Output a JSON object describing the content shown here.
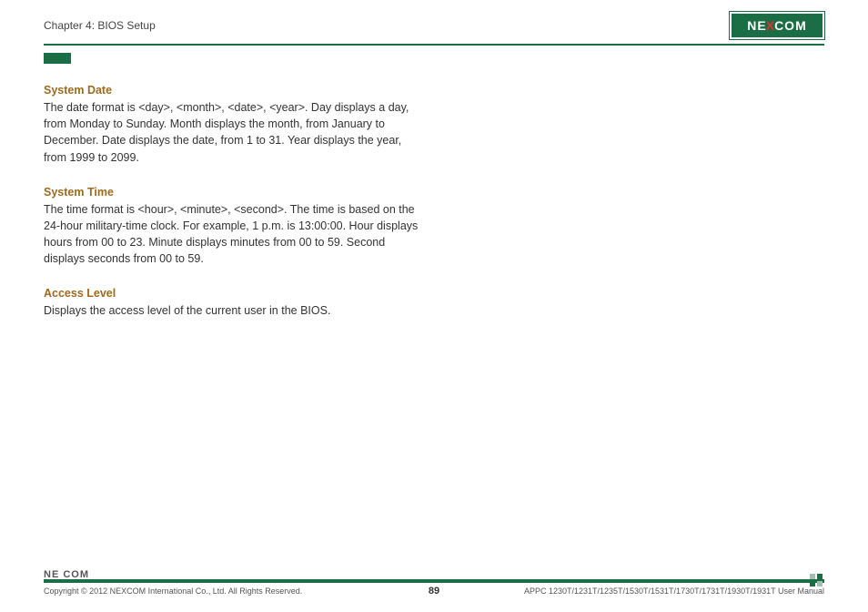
{
  "header": {
    "chapter": "Chapter 4: BIOS Setup",
    "logo_pre": "NE",
    "logo_x": "X",
    "logo_post": "COM"
  },
  "sections": [
    {
      "heading": "System Date",
      "body": "The date format is <day>, <month>, <date>, <year>. Day displays a day, from Monday to Sunday. Month displays the month, from January to December. Date displays the date, from 1 to 31. Year displays the year, from 1999 to 2099."
    },
    {
      "heading": "System Time",
      "body": "The time format is <hour>, <minute>, <second>. The time is based on the 24-hour military-time clock. For example, 1 p.m. is 13:00:00. Hour displays hours from 00 to 23. Minute displays minutes from 00 to 59. Second displays seconds from 00 to 59."
    },
    {
      "heading": "Access Level",
      "body": "Displays the access level of the current user in the BIOS."
    }
  ],
  "footer": {
    "logo_text": "NE COM",
    "copyright": "Copyright © 2012 NEXCOM International Co., Ltd. All Rights Reserved.",
    "page": "89",
    "doc": "APPC 1230T/1231T/1235T/1530T/1531T/1730T/1731T/1930T/1931T User Manual"
  }
}
